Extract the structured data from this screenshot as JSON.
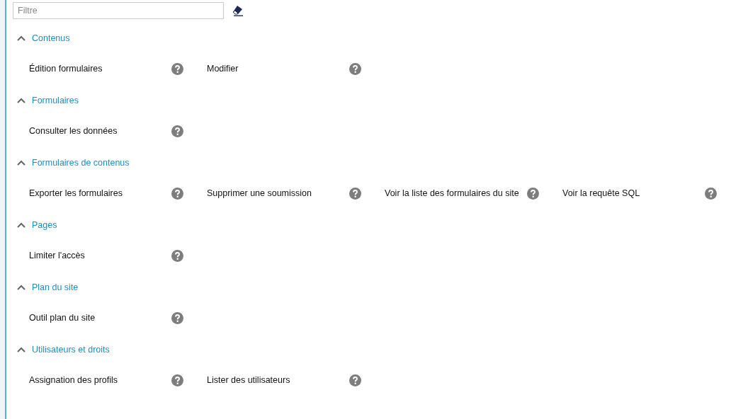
{
  "filter": {
    "placeholder": "Filtre"
  },
  "sections": [
    {
      "title": "Contenus",
      "expanded": true,
      "items": [
        "Édition formulaires",
        "Modifier"
      ]
    },
    {
      "title": "Formulaires",
      "expanded": true,
      "items": [
        "Consulter les données"
      ]
    },
    {
      "title": "Formulaires de contenus",
      "expanded": true,
      "items": [
        "Exporter les formulaires",
        "Supprimer une soumission",
        "Voir la liste des formulaires du site",
        "Voir la requête SQL"
      ]
    },
    {
      "title": "Pages",
      "expanded": true,
      "items": [
        "Limiter l'accès"
      ]
    },
    {
      "title": "Plan du site",
      "expanded": true,
      "items": [
        "Outil plan du site"
      ]
    },
    {
      "title": "Utilisateurs et droits",
      "expanded": true,
      "items": [
        "Assignation des profils",
        "Lister des utilisateurs"
      ]
    }
  ]
}
